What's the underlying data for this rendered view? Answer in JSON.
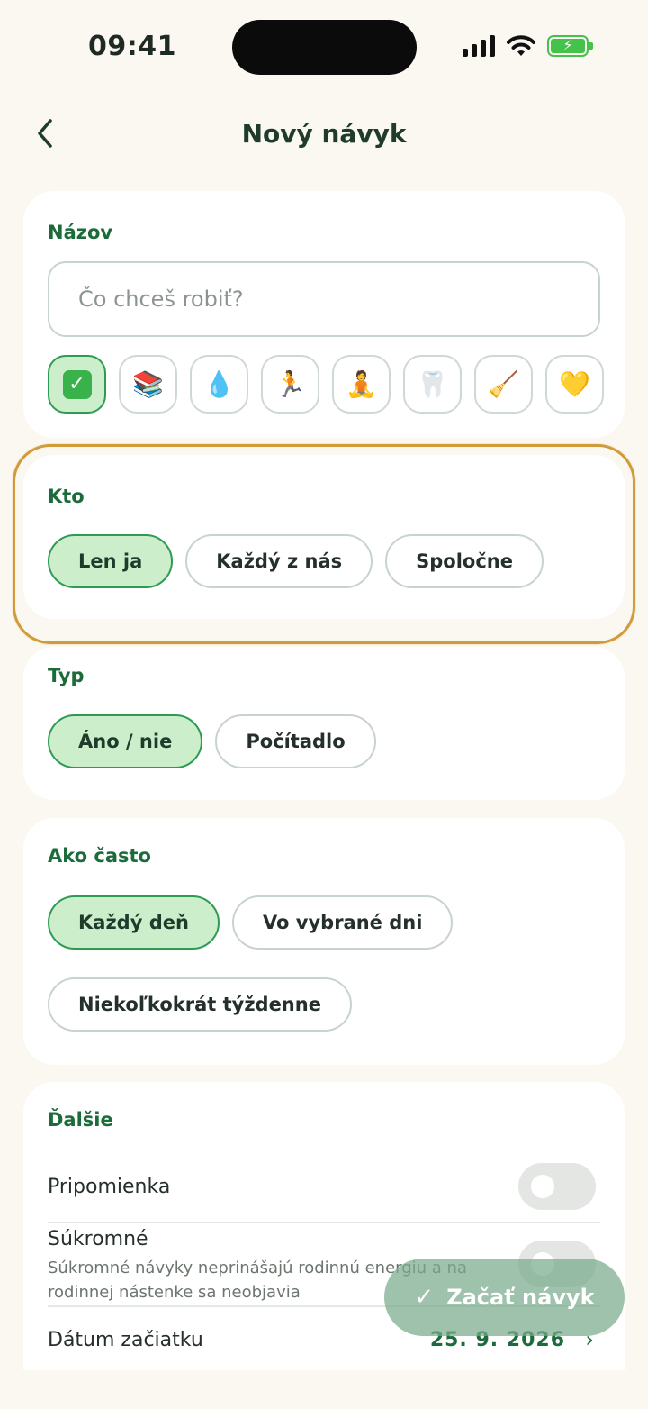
{
  "status_bar": {
    "time": "09:41"
  },
  "header": {
    "title": "Nový návyk",
    "back_icon": "chevron-left-icon"
  },
  "name_card": {
    "label": "Názov",
    "input_placeholder": "Čo chceš robiť?",
    "input_value": "",
    "emojis": [
      {
        "name": "check-emoji",
        "glyph": "✓",
        "selected": true
      },
      {
        "name": "books-emoji",
        "glyph": "📚",
        "selected": false
      },
      {
        "name": "droplet-emoji",
        "glyph": "💧",
        "selected": false
      },
      {
        "name": "runner-emoji",
        "glyph": "🏃",
        "selected": false
      },
      {
        "name": "meditation-emoji",
        "glyph": "🧘",
        "selected": false
      },
      {
        "name": "tooth-emoji",
        "glyph": "🦷",
        "selected": false
      },
      {
        "name": "broom-emoji",
        "glyph": "🧹",
        "selected": false
      },
      {
        "name": "heart-emoji",
        "glyph": "💛",
        "selected": false
      }
    ]
  },
  "who_card": {
    "label": "Kto",
    "options": [
      "Len ja",
      "Každý z nás",
      "Spoločne"
    ],
    "selected": "Len ja"
  },
  "type_card": {
    "label": "Typ",
    "options": [
      "Áno / nie",
      "Počítadlo"
    ],
    "selected": "Áno / nie"
  },
  "frequency_card": {
    "label": "Ako často",
    "options": [
      "Každý deň",
      "Vo vybrané dni",
      "Niekoľkokrát týždenne"
    ],
    "selected": "Každý deň"
  },
  "more_card": {
    "label": "Ďalšie",
    "reminder_label": "Pripomienka",
    "reminder_on": false,
    "private_label": "Súkromné",
    "private_desc": "Súkromné návyky neprinášajú rodinnú energiu a na rodinnej nástenke sa neobjavia",
    "private_on": false,
    "start_date_label": "Dátum začiatku",
    "start_date_value": "25. 9. 2026"
  },
  "fab": {
    "label": "Začať návyk",
    "icon": "checkmark-icon"
  },
  "colors": {
    "accent": "#1c6b3a",
    "selected_chip": "#cdeecb",
    "highlight": "#d29b3a",
    "background": "#faf8f0"
  }
}
